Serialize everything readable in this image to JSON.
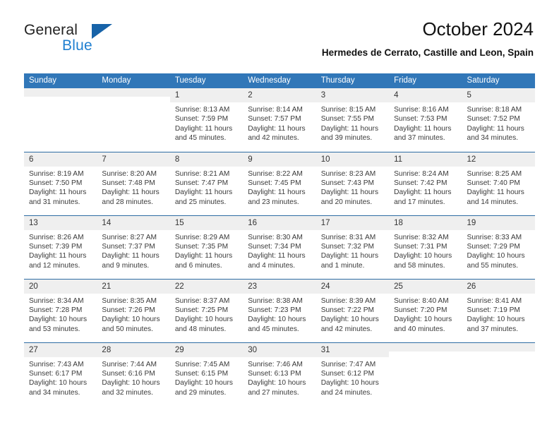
{
  "logo": {
    "word1": "General",
    "word2": "Blue",
    "triangle_color": "#1763a8",
    "blue_text_color": "#1f7fd0"
  },
  "header": {
    "title": "October 2024",
    "subtitle": "Hermedes de Cerrato, Castille and Leon, Spain",
    "header_bg": "#3177b8",
    "header_text": "#ffffff"
  },
  "weekday_headers": [
    "Sunday",
    "Monday",
    "Tuesday",
    "Wednesday",
    "Thursday",
    "Friday",
    "Saturday"
  ],
  "labels": {
    "sunrise_prefix": "Sunrise:",
    "sunset_prefix": "Sunset:",
    "daylight_prefix": "Daylight:"
  },
  "weeks": [
    [
      {
        "empty": true,
        "day": ""
      },
      {
        "empty": true,
        "day": ""
      },
      {
        "empty": false,
        "day": "1",
        "sunrise": "Sunrise: 8:13 AM",
        "sunset": "Sunset: 7:59 PM",
        "daylight_line1": "Daylight: 11 hours",
        "daylight_line2": "and 45 minutes."
      },
      {
        "empty": false,
        "day": "2",
        "sunrise": "Sunrise: 8:14 AM",
        "sunset": "Sunset: 7:57 PM",
        "daylight_line1": "Daylight: 11 hours",
        "daylight_line2": "and 42 minutes."
      },
      {
        "empty": false,
        "day": "3",
        "sunrise": "Sunrise: 8:15 AM",
        "sunset": "Sunset: 7:55 PM",
        "daylight_line1": "Daylight: 11 hours",
        "daylight_line2": "and 39 minutes."
      },
      {
        "empty": false,
        "day": "4",
        "sunrise": "Sunrise: 8:16 AM",
        "sunset": "Sunset: 7:53 PM",
        "daylight_line1": "Daylight: 11 hours",
        "daylight_line2": "and 37 minutes."
      },
      {
        "empty": false,
        "day": "5",
        "sunrise": "Sunrise: 8:18 AM",
        "sunset": "Sunset: 7:52 PM",
        "daylight_line1": "Daylight: 11 hours",
        "daylight_line2": "and 34 minutes."
      }
    ],
    [
      {
        "empty": false,
        "day": "6",
        "sunrise": "Sunrise: 8:19 AM",
        "sunset": "Sunset: 7:50 PM",
        "daylight_line1": "Daylight: 11 hours",
        "daylight_line2": "and 31 minutes."
      },
      {
        "empty": false,
        "day": "7",
        "sunrise": "Sunrise: 8:20 AM",
        "sunset": "Sunset: 7:48 PM",
        "daylight_line1": "Daylight: 11 hours",
        "daylight_line2": "and 28 minutes."
      },
      {
        "empty": false,
        "day": "8",
        "sunrise": "Sunrise: 8:21 AM",
        "sunset": "Sunset: 7:47 PM",
        "daylight_line1": "Daylight: 11 hours",
        "daylight_line2": "and 25 minutes."
      },
      {
        "empty": false,
        "day": "9",
        "sunrise": "Sunrise: 8:22 AM",
        "sunset": "Sunset: 7:45 PM",
        "daylight_line1": "Daylight: 11 hours",
        "daylight_line2": "and 23 minutes."
      },
      {
        "empty": false,
        "day": "10",
        "sunrise": "Sunrise: 8:23 AM",
        "sunset": "Sunset: 7:43 PM",
        "daylight_line1": "Daylight: 11 hours",
        "daylight_line2": "and 20 minutes."
      },
      {
        "empty": false,
        "day": "11",
        "sunrise": "Sunrise: 8:24 AM",
        "sunset": "Sunset: 7:42 PM",
        "daylight_line1": "Daylight: 11 hours",
        "daylight_line2": "and 17 minutes."
      },
      {
        "empty": false,
        "day": "12",
        "sunrise": "Sunrise: 8:25 AM",
        "sunset": "Sunset: 7:40 PM",
        "daylight_line1": "Daylight: 11 hours",
        "daylight_line2": "and 14 minutes."
      }
    ],
    [
      {
        "empty": false,
        "day": "13",
        "sunrise": "Sunrise: 8:26 AM",
        "sunset": "Sunset: 7:39 PM",
        "daylight_line1": "Daylight: 11 hours",
        "daylight_line2": "and 12 minutes."
      },
      {
        "empty": false,
        "day": "14",
        "sunrise": "Sunrise: 8:27 AM",
        "sunset": "Sunset: 7:37 PM",
        "daylight_line1": "Daylight: 11 hours",
        "daylight_line2": "and 9 minutes."
      },
      {
        "empty": false,
        "day": "15",
        "sunrise": "Sunrise: 8:29 AM",
        "sunset": "Sunset: 7:35 PM",
        "daylight_line1": "Daylight: 11 hours",
        "daylight_line2": "and 6 minutes."
      },
      {
        "empty": false,
        "day": "16",
        "sunrise": "Sunrise: 8:30 AM",
        "sunset": "Sunset: 7:34 PM",
        "daylight_line1": "Daylight: 11 hours",
        "daylight_line2": "and 4 minutes."
      },
      {
        "empty": false,
        "day": "17",
        "sunrise": "Sunrise: 8:31 AM",
        "sunset": "Sunset: 7:32 PM",
        "daylight_line1": "Daylight: 11 hours",
        "daylight_line2": "and 1 minute."
      },
      {
        "empty": false,
        "day": "18",
        "sunrise": "Sunrise: 8:32 AM",
        "sunset": "Sunset: 7:31 PM",
        "daylight_line1": "Daylight: 10 hours",
        "daylight_line2": "and 58 minutes."
      },
      {
        "empty": false,
        "day": "19",
        "sunrise": "Sunrise: 8:33 AM",
        "sunset": "Sunset: 7:29 PM",
        "daylight_line1": "Daylight: 10 hours",
        "daylight_line2": "and 55 minutes."
      }
    ],
    [
      {
        "empty": false,
        "day": "20",
        "sunrise": "Sunrise: 8:34 AM",
        "sunset": "Sunset: 7:28 PM",
        "daylight_line1": "Daylight: 10 hours",
        "daylight_line2": "and 53 minutes."
      },
      {
        "empty": false,
        "day": "21",
        "sunrise": "Sunrise: 8:35 AM",
        "sunset": "Sunset: 7:26 PM",
        "daylight_line1": "Daylight: 10 hours",
        "daylight_line2": "and 50 minutes."
      },
      {
        "empty": false,
        "day": "22",
        "sunrise": "Sunrise: 8:37 AM",
        "sunset": "Sunset: 7:25 PM",
        "daylight_line1": "Daylight: 10 hours",
        "daylight_line2": "and 48 minutes."
      },
      {
        "empty": false,
        "day": "23",
        "sunrise": "Sunrise: 8:38 AM",
        "sunset": "Sunset: 7:23 PM",
        "daylight_line1": "Daylight: 10 hours",
        "daylight_line2": "and 45 minutes."
      },
      {
        "empty": false,
        "day": "24",
        "sunrise": "Sunrise: 8:39 AM",
        "sunset": "Sunset: 7:22 PM",
        "daylight_line1": "Daylight: 10 hours",
        "daylight_line2": "and 42 minutes."
      },
      {
        "empty": false,
        "day": "25",
        "sunrise": "Sunrise: 8:40 AM",
        "sunset": "Sunset: 7:20 PM",
        "daylight_line1": "Daylight: 10 hours",
        "daylight_line2": "and 40 minutes."
      },
      {
        "empty": false,
        "day": "26",
        "sunrise": "Sunrise: 8:41 AM",
        "sunset": "Sunset: 7:19 PM",
        "daylight_line1": "Daylight: 10 hours",
        "daylight_line2": "and 37 minutes."
      }
    ],
    [
      {
        "empty": false,
        "day": "27",
        "sunrise": "Sunrise: 7:43 AM",
        "sunset": "Sunset: 6:17 PM",
        "daylight_line1": "Daylight: 10 hours",
        "daylight_line2": "and 34 minutes."
      },
      {
        "empty": false,
        "day": "28",
        "sunrise": "Sunrise: 7:44 AM",
        "sunset": "Sunset: 6:16 PM",
        "daylight_line1": "Daylight: 10 hours",
        "daylight_line2": "and 32 minutes."
      },
      {
        "empty": false,
        "day": "29",
        "sunrise": "Sunrise: 7:45 AM",
        "sunset": "Sunset: 6:15 PM",
        "daylight_line1": "Daylight: 10 hours",
        "daylight_line2": "and 29 minutes."
      },
      {
        "empty": false,
        "day": "30",
        "sunrise": "Sunrise: 7:46 AM",
        "sunset": "Sunset: 6:13 PM",
        "daylight_line1": "Daylight: 10 hours",
        "daylight_line2": "and 27 minutes."
      },
      {
        "empty": false,
        "day": "31",
        "sunrise": "Sunrise: 7:47 AM",
        "sunset": "Sunset: 6:12 PM",
        "daylight_line1": "Daylight: 10 hours",
        "daylight_line2": "and 24 minutes."
      },
      {
        "empty": true,
        "day": ""
      },
      {
        "empty": true,
        "day": ""
      }
    ]
  ]
}
